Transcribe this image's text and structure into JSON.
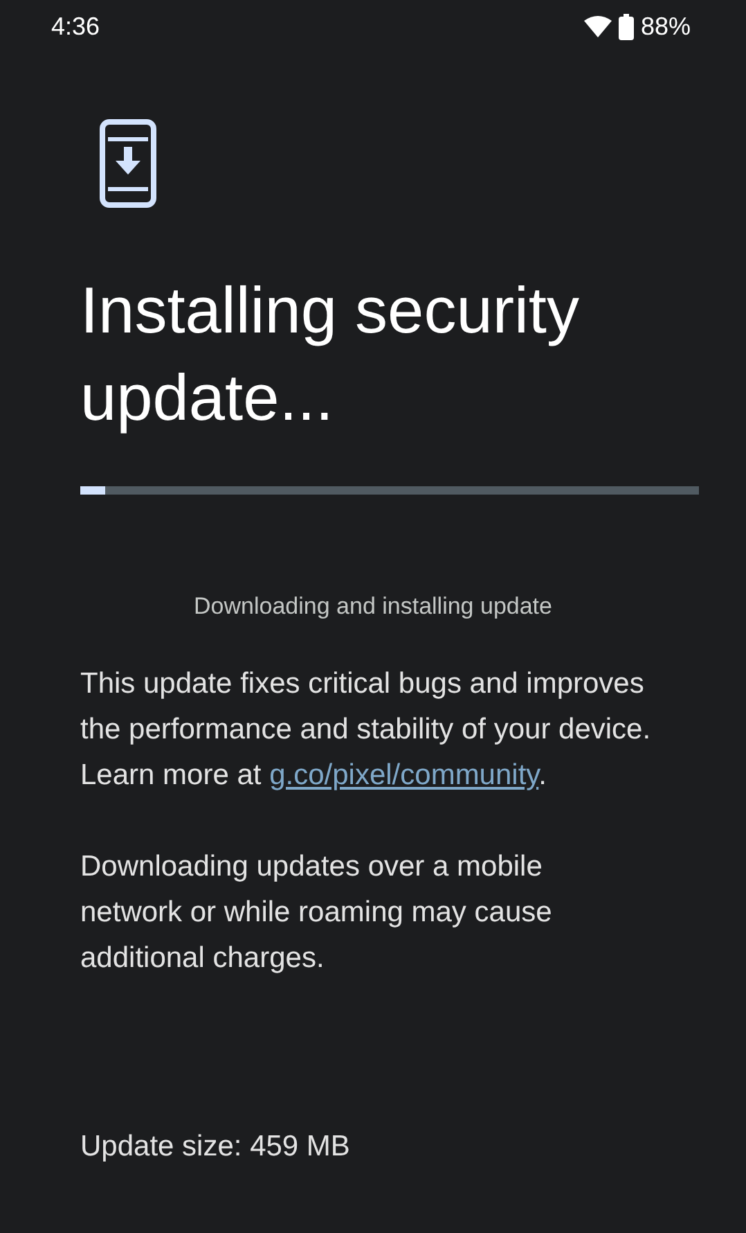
{
  "status_bar": {
    "time": "4:36",
    "battery": "88%"
  },
  "title": "Installing security update...",
  "progress": {
    "level": 0.04
  },
  "status_text": "Downloading and installing update",
  "description": {
    "text": "This update fixes critical bugs and improves the performance and stability of your device. Learn more at",
    "link": "g.co/pixel/community",
    "after": "."
  },
  "note": "Downloading updates over a mobile network or while roaming may cause additional charges.",
  "update_size": "Update size: 459 MB"
}
